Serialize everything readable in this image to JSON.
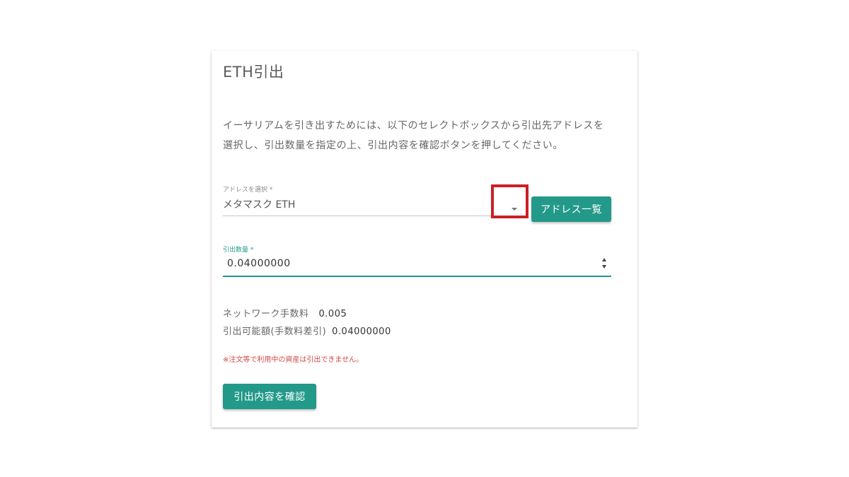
{
  "title": "ETH引出",
  "description": [
    "イーサリアムを引き出すためには、以下のセレクトボックスから引出先アドレスを",
    "選択し、引出数量を指定の上、引出内容を確認ボタンを押してください。"
  ],
  "address_select": {
    "label": "アドレスを選択 *",
    "value": "メタマスク ETH",
    "icon": "chevron-down-icon"
  },
  "address_list_button": "アドレス一覧",
  "amount": {
    "label": "引出数量 *",
    "value": "0.04000000"
  },
  "network_fee": {
    "label": "ネットワーク手数料",
    "value": "0.005"
  },
  "withdrawable": {
    "label": "引出可能額(手数料差引)",
    "value": "0.04000000"
  },
  "warning": "※注文等で利用中の資産は引出できません。",
  "confirm_button": "引出内容を確認",
  "colors": {
    "accent": "#23998a",
    "highlight": "#cc1f26",
    "warning": "#d24a4a"
  }
}
